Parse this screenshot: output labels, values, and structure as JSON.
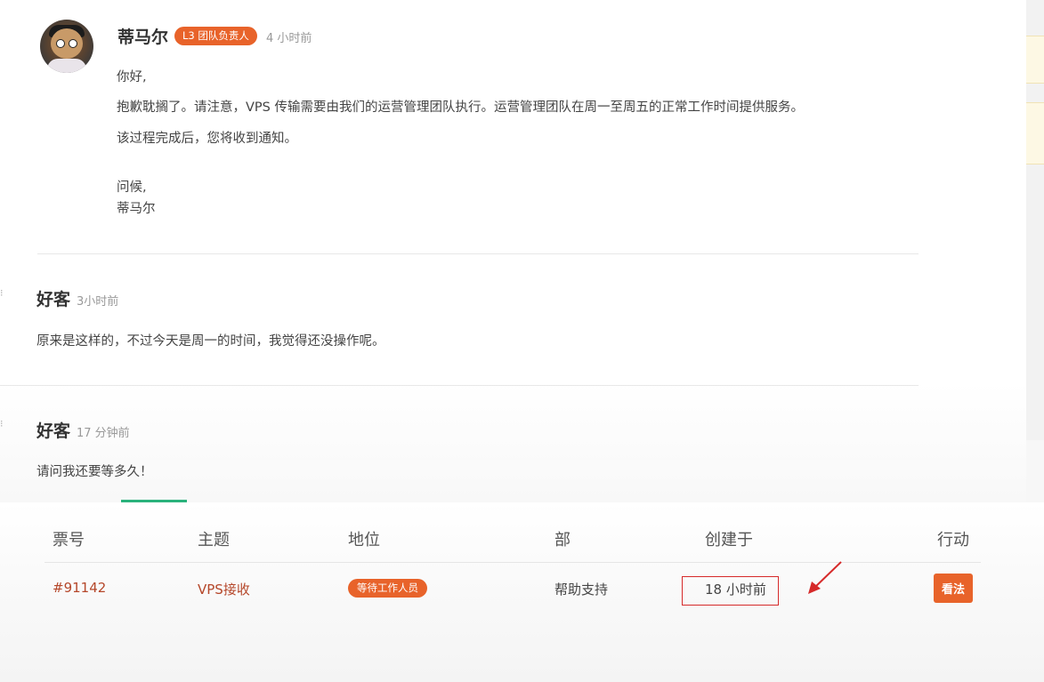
{
  "thread": {
    "reply1": {
      "author": "蒂马尔",
      "badge": "L3 团队负责人",
      "time": "4 小时前",
      "lines": [
        "你好,",
        "抱歉耽搁了。请注意，VPS 传输需要由我们的运营管理团队执行。运营管理团队在周一至周五的正常工作时间提供服务。",
        "该过程完成后，您将收到通知。",
        "问候,",
        "蒂马尔"
      ]
    },
    "reply2": {
      "author": "好客",
      "time": "3小时前",
      "text": "原来是这样的，不过今天是周一的时间，我觉得还没操作呢。"
    },
    "reply3": {
      "author": "好客",
      "time": "17 分钟前",
      "text": "请问我还要等多久！"
    }
  },
  "table": {
    "headers": [
      "票号",
      "主题",
      "地位",
      "部",
      "创建于",
      "行动"
    ],
    "rows": [
      {
        "ticket": "#91142",
        "subject": "VPS接收",
        "status": "等待工作人员",
        "department": "帮助支持",
        "created": "18 小时前",
        "action": "看法"
      }
    ]
  },
  "colors": {
    "accent": "#e8632a",
    "link": "#b5472a",
    "highlight": "#d62a2a",
    "tab_active": "#2ab27b"
  }
}
